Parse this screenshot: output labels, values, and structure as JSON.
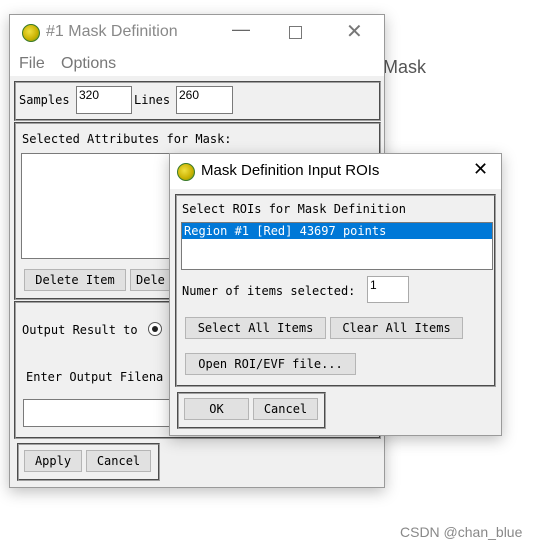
{
  "background": {
    "behind_text": "Mask",
    "watermark": "CSDN @chan_blue"
  },
  "main_window": {
    "title": "#1 Mask Definition",
    "menu": [
      "File",
      "Options"
    ],
    "samples_label": "Samples",
    "samples_value": "320",
    "lines_label": "Lines",
    "lines_value": "260",
    "attributes_label": "Selected Attributes for Mask:",
    "delete_item": "Delete Item",
    "delete_partial": "Dele",
    "output_label": "Output Result to",
    "output_filename_label": "Enter Output Filena",
    "output_filename_value": "",
    "apply": "Apply",
    "cancel": "Cancel"
  },
  "dialog": {
    "title": "Mask Definition Input ROIs",
    "list_label": "Select ROIs for Mask Definition",
    "items": [
      {
        "label": "Region #1 [Red] 43697 points",
        "selected": true
      }
    ],
    "count_label": "Numer of items selected:",
    "count_value": "1",
    "select_all": "Select All Items",
    "clear_all": "Clear All Items",
    "open_file": "Open ROI/EVF file...",
    "ok": "OK",
    "cancel": "Cancel"
  },
  "colors": {
    "selection": "#0078d7",
    "window_bg": "#f0f0f0"
  }
}
